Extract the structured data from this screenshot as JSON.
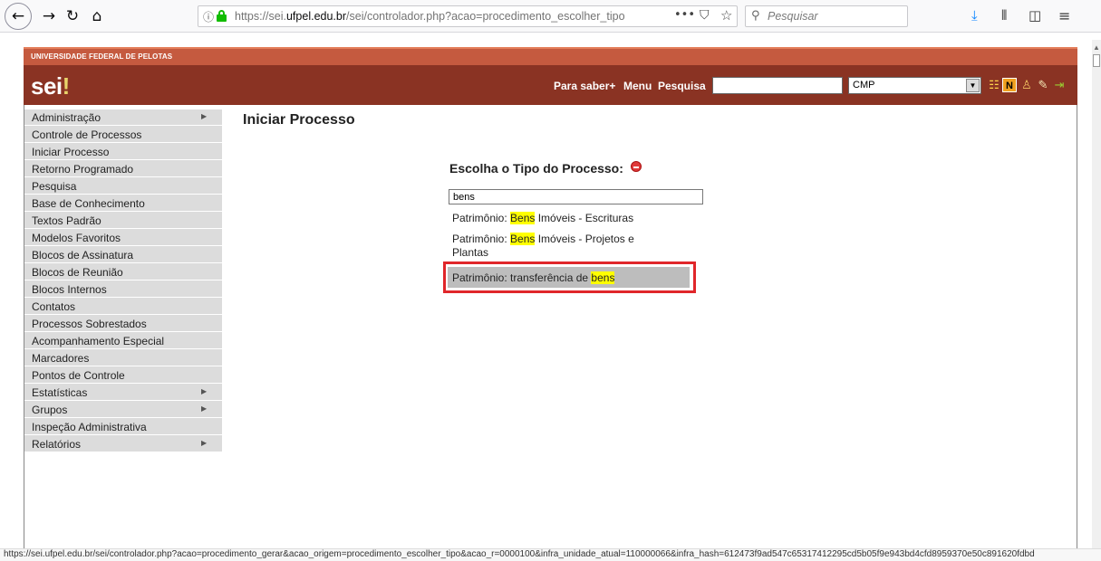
{
  "browser": {
    "url_prefix": "https://sei.",
    "url_domain": "ufpel.edu.br",
    "url_path": "/sei/controlador.php?acao=procedimento_escolher_tipo&",
    "search_placeholder": "Pesquisar",
    "status_url": "https://sei.ufpel.edu.br/sei/controlador.php?acao=procedimento_gerar&acao_origem=procedimento_escolher_tipo&acao_r=0000100&infra_unidade_atual=110000066&infra_hash=612473f9ad547c65317412295cd5b05f9e943bd4cfd8959370e50c891620fdbd"
  },
  "header": {
    "university": "UNIVERSIDADE FEDERAL DE PELOTAS",
    "logo": "sei",
    "logo_mark": "!",
    "links": [
      "Para saber+",
      "Menu",
      "Pesquisa"
    ],
    "unit_select": "CMP"
  },
  "sidebar": {
    "items": [
      {
        "label": "Administração",
        "submenu": true
      },
      {
        "label": "Controle de Processos",
        "submenu": false
      },
      {
        "label": "Iniciar Processo",
        "submenu": false
      },
      {
        "label": "Retorno Programado",
        "submenu": false
      },
      {
        "label": "Pesquisa",
        "submenu": false
      },
      {
        "label": "Base de Conhecimento",
        "submenu": false
      },
      {
        "label": "Textos Padrão",
        "submenu": false
      },
      {
        "label": "Modelos Favoritos",
        "submenu": false
      },
      {
        "label": "Blocos de Assinatura",
        "submenu": false
      },
      {
        "label": "Blocos de Reunião",
        "submenu": false
      },
      {
        "label": "Blocos Internos",
        "submenu": false
      },
      {
        "label": "Contatos",
        "submenu": false
      },
      {
        "label": "Processos Sobrestados",
        "submenu": false
      },
      {
        "label": "Acompanhamento Especial",
        "submenu": false
      },
      {
        "label": "Marcadores",
        "submenu": false
      },
      {
        "label": "Pontos de Controle",
        "submenu": false
      },
      {
        "label": "Estatísticas",
        "submenu": true
      },
      {
        "label": "Grupos",
        "submenu": true
      },
      {
        "label": "Inspeção Administrativa",
        "submenu": false
      },
      {
        "label": "Relatórios",
        "submenu": true
      }
    ],
    "submenu_marker": "▶"
  },
  "main": {
    "title": "Iniciar Processo",
    "section_title": "Escolha o Tipo do Processo:",
    "filter_value": "bens",
    "options": [
      {
        "prefix": "Patrimônio: ",
        "highlight": "Bens",
        "suffix": " Imóveis - Escrituras"
      },
      {
        "prefix": "Patrimônio: ",
        "highlight": "Bens",
        "suffix": " Imóveis - Projetos e",
        "line2": "Plantas"
      },
      {
        "prefix": "Patrimônio: transferência de ",
        "highlight": "bens",
        "suffix": ""
      }
    ]
  },
  "colors": {
    "banner_top": "#c55a3f",
    "banner_main": "#8a3323",
    "sidebar_bg": "#dcdcdc",
    "highlight": "#ffff00",
    "annotation_box": "#e0262a"
  }
}
